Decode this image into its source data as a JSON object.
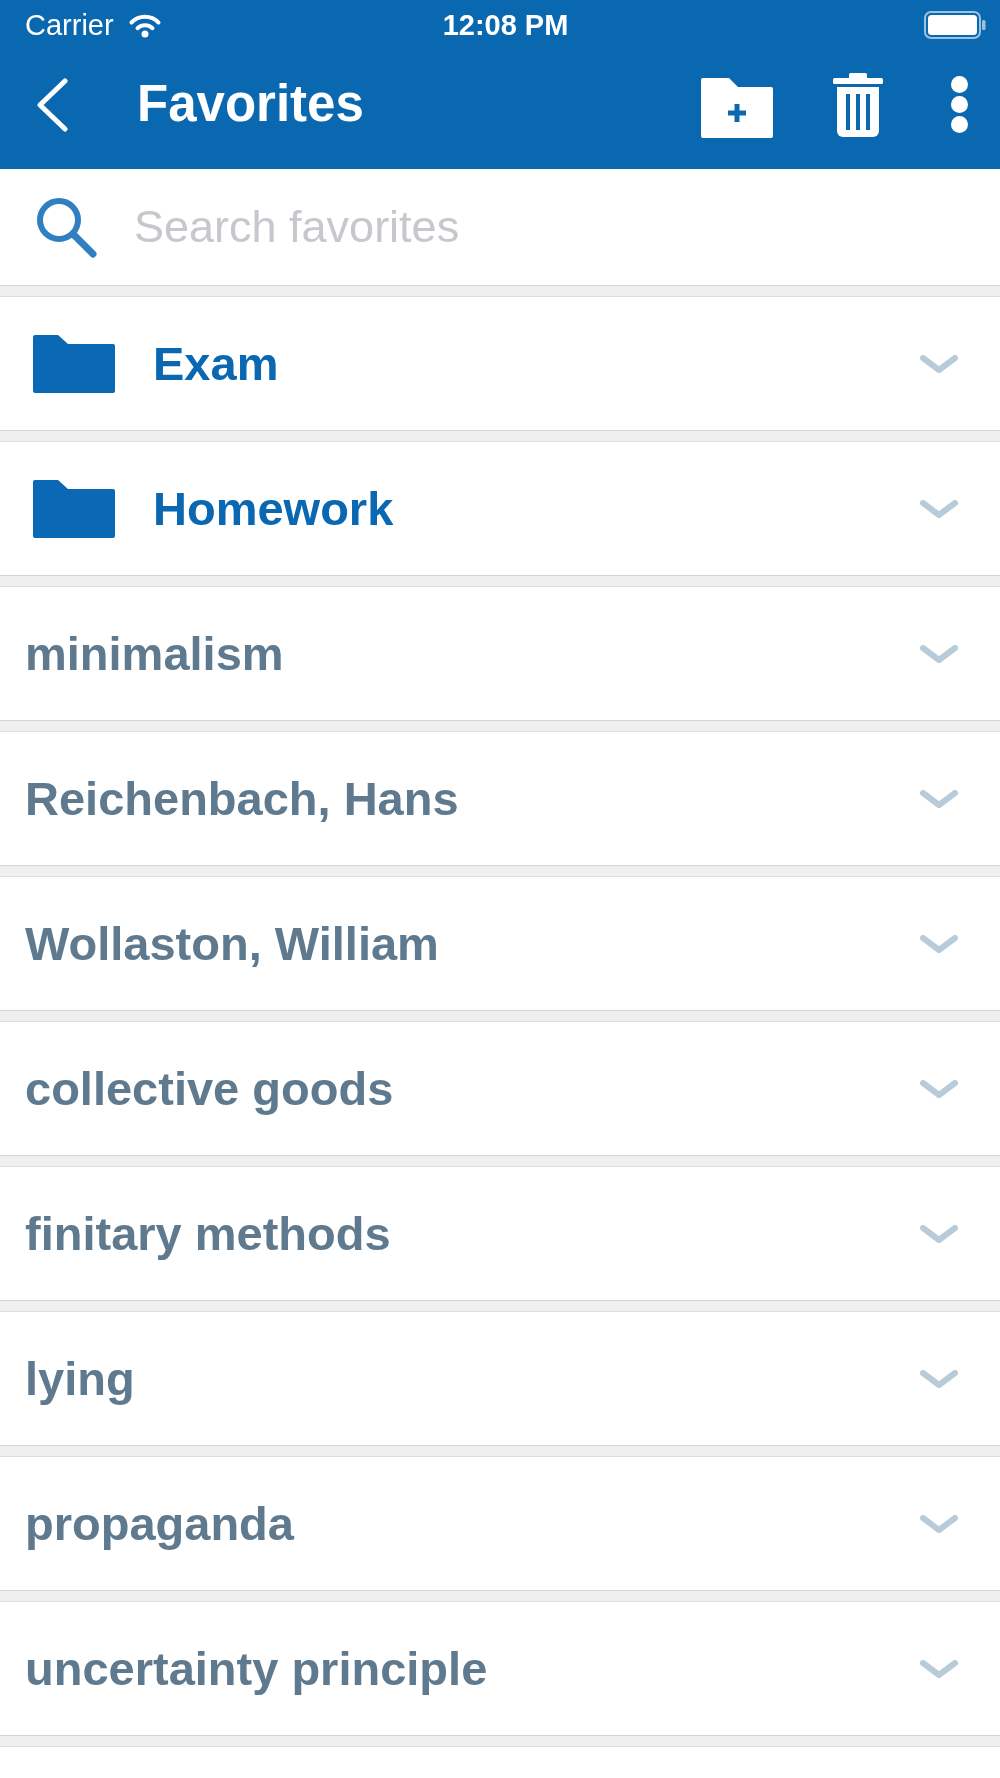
{
  "status_bar": {
    "carrier": "Carrier",
    "time": "12:08 PM"
  },
  "header": {
    "title": "Favorites"
  },
  "search": {
    "placeholder": "Search favorites"
  },
  "items": [
    {
      "kind": "folder",
      "label": "Exam",
      "expanded": false
    },
    {
      "kind": "folder",
      "label": "Homework",
      "expanded": false
    },
    {
      "kind": "term",
      "label": "minimalism",
      "expanded": false
    },
    {
      "kind": "term",
      "label": "Reichenbach, Hans",
      "expanded": false
    },
    {
      "kind": "term",
      "label": "Wollaston, William",
      "expanded": false
    },
    {
      "kind": "term",
      "label": "collective goods",
      "expanded": false
    },
    {
      "kind": "term",
      "label": "finitary methods",
      "expanded": false
    },
    {
      "kind": "term",
      "label": "lying",
      "expanded": false
    },
    {
      "kind": "term",
      "label": "propaganda",
      "expanded": false
    },
    {
      "kind": "term",
      "label": "uncertainty principle",
      "expanded": false
    }
  ]
}
